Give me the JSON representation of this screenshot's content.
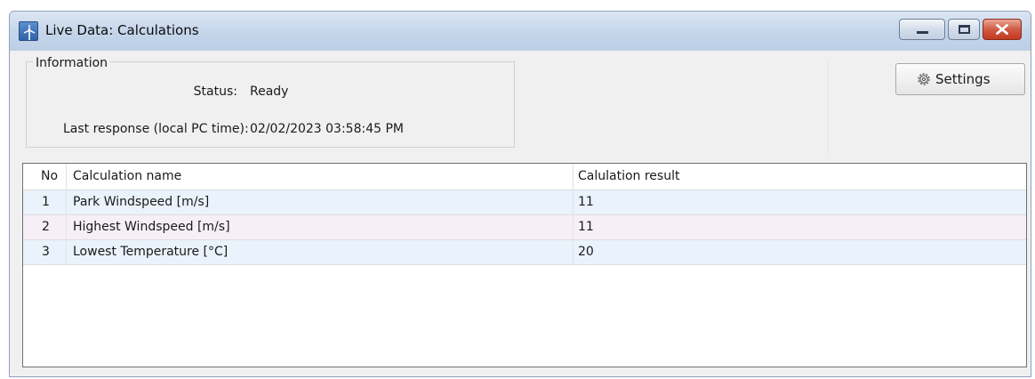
{
  "window": {
    "title": "Live Data: Calculations"
  },
  "info": {
    "group_title": "Information",
    "status_label": "Status:",
    "status_value": "Ready",
    "response_label": "Last response (local PC time):",
    "response_value": "02/02/2023 03:58:45 PM"
  },
  "settings": {
    "label": "Settings",
    "icon": "gear-icon"
  },
  "table": {
    "columns": [
      "No",
      "Calculation name",
      "Calulation result"
    ],
    "rows": [
      {
        "no": "1",
        "name": "Park Windspeed [m/s]",
        "result": "11"
      },
      {
        "no": "2",
        "name": "Highest Windspeed [m/s]",
        "result": "11"
      },
      {
        "no": "3",
        "name": "Lowest Temperature [°C]",
        "result": "20"
      }
    ]
  },
  "colors": {
    "titlebar": "#c4d5ea",
    "close_button": "#c43a22",
    "row_odd": "#eaf2fb",
    "row_even": "#f6f0f6"
  }
}
